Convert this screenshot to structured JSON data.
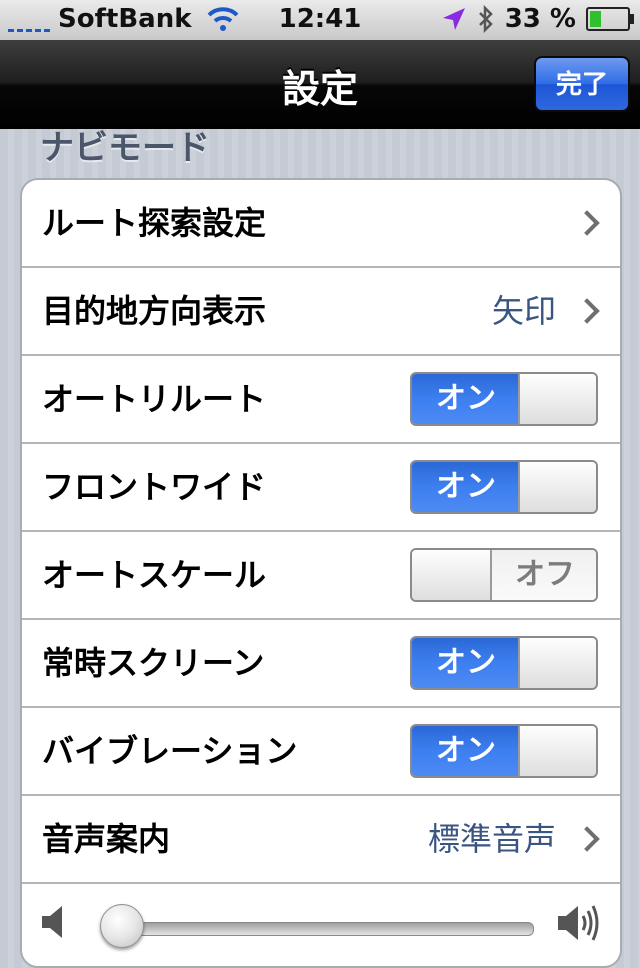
{
  "status_bar": {
    "carrier": "SoftBank",
    "time": "12:41",
    "battery": "33 %",
    "battery_level": 0.33,
    "icons": [
      "signal-icon",
      "wifi-icon",
      "location-arrow-icon",
      "bluetooth-icon",
      "battery-icon"
    ]
  },
  "navbar": {
    "title": "設定",
    "done_label": "完了"
  },
  "section": {
    "header": "ナビモード"
  },
  "rows": [
    {
      "label": "ルート探索設定",
      "type": "disclosure",
      "value": ""
    },
    {
      "label": "目的地方向表示",
      "type": "disclosure",
      "value": "矢印"
    },
    {
      "label": "オートリルート",
      "type": "toggle",
      "state": "on"
    },
    {
      "label": "フロントワイド",
      "type": "toggle",
      "state": "on"
    },
    {
      "label": "オートスケール",
      "type": "toggle",
      "state": "off"
    },
    {
      "label": "常時スクリーン",
      "type": "toggle",
      "state": "on"
    },
    {
      "label": "バイブレーション",
      "type": "toggle",
      "state": "on"
    },
    {
      "label": "音声案内",
      "type": "disclosure",
      "value": "標準音声"
    }
  ],
  "toggle_labels": {
    "on": "オン",
    "off": "オフ"
  },
  "volume": {
    "level": 0.0
  },
  "colors": {
    "toggle_on": "#3d7ff0",
    "value_text": "#3b5583",
    "done_button": "#2f6ce5"
  }
}
